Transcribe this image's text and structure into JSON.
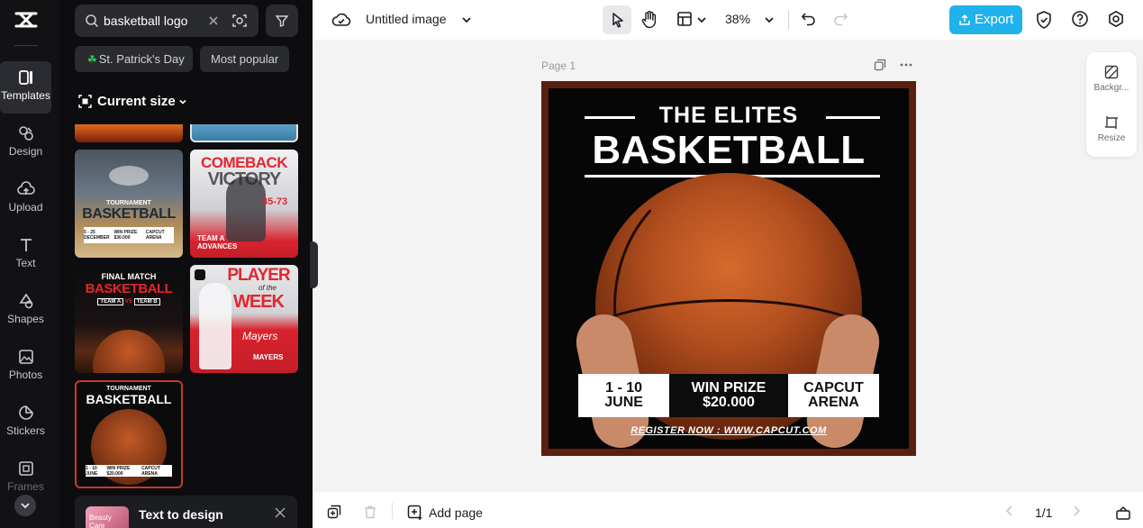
{
  "rail": {
    "items": [
      {
        "label": "Templates"
      },
      {
        "label": "Design"
      },
      {
        "label": "Upload"
      },
      {
        "label": "Text"
      },
      {
        "label": "Shapes"
      },
      {
        "label": "Photos"
      },
      {
        "label": "Stickers"
      },
      {
        "label": "Frames"
      }
    ]
  },
  "panel": {
    "search_value": "basketball logo",
    "chips": [
      "St. Patrick's Day",
      "Most popular"
    ],
    "size_selector": "Current size",
    "templates": {
      "t1": {
        "title_small": "TOURNAMENT",
        "title_big": "BASKETBALL",
        "info": [
          "5 - 25 DECEMBER",
          "WIN PRIZE $30.000",
          "CAPCUT ARENA"
        ]
      },
      "t2": {
        "line1": "COMEBACK",
        "line2": "VICTORY",
        "score": "85-73",
        "foot1": "TEAM A",
        "foot2": "ADVANCES"
      },
      "t3": {
        "line1": "FINAL MATCH",
        "line2": "BASKETBALL",
        "team_a": "TEAM A",
        "vs": "VS",
        "team_b": "TEAM B"
      },
      "t4": {
        "line1": "PLAYER",
        "line2": "of the",
        "line3": "WEEK",
        "name_script": "Mayers",
        "name": "MAYERS"
      },
      "t5": {
        "title_small": "TOURNAMENT",
        "title_big": "BASKETBALL",
        "info": [
          "1 - 10 JUNE",
          "WIN PRIZE $20.000",
          "CAPCUT ARENA"
        ]
      }
    },
    "text_to_design": {
      "label": "Text to design",
      "thumb_text": "Beauty Care"
    }
  },
  "toolbar": {
    "doc_title": "Untitled image",
    "zoom": "38%",
    "export_label": "Export"
  },
  "canvas": {
    "page_label": "Page 1",
    "design": {
      "line1": "THE ELITES",
      "line2": "BASKETBALL",
      "date": "1 - 10\nJUNE",
      "prize": "WIN PRIZE\n$20.000",
      "venue": "CAPCUT\nARENA",
      "register": "REGISTER NOW : WWW.CAPCUT.COM"
    }
  },
  "right_panel": {
    "background_label": "Backgr...",
    "resize_label": "Resize"
  },
  "bottom": {
    "add_page_label": "Add page",
    "pager": "1/1"
  }
}
